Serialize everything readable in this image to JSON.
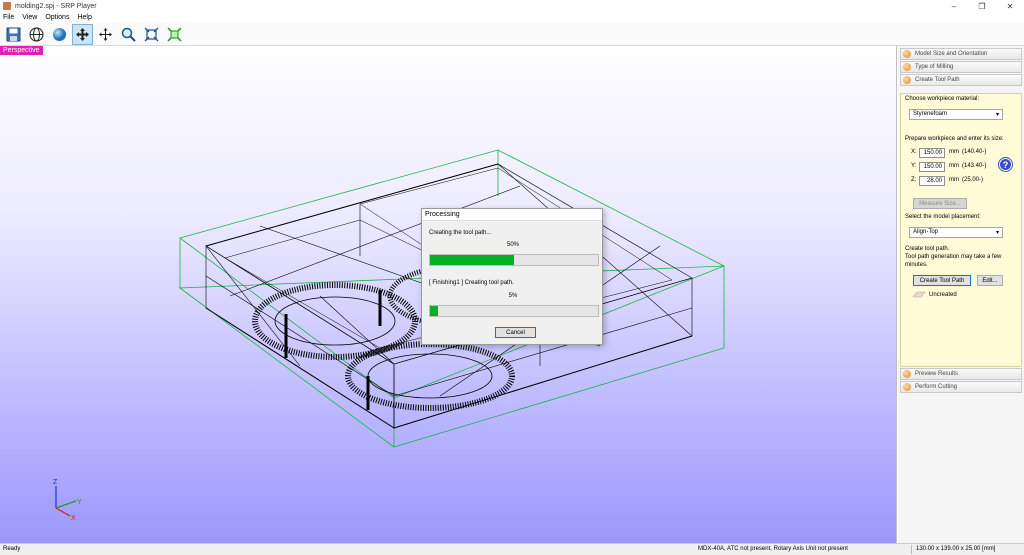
{
  "window": {
    "title": "molding2.spj - SRP Player",
    "controls": [
      "–",
      "❐",
      "✕"
    ]
  },
  "menu": [
    "File",
    "View",
    "Options",
    "Help"
  ],
  "toolbar": {
    "buttons": [
      "save-icon",
      "globe-wire-icon",
      "sphere-icon",
      "rotate-move-icon",
      "pan-icon",
      "zoom-icon",
      "fit-icon",
      "fit-all-icon"
    ],
    "active": "rotate-move-icon"
  },
  "viewport": {
    "view_label": "Perspective",
    "axes": {
      "z": "Z",
      "y": "Y",
      "x": "X"
    }
  },
  "dialog": {
    "title": "Processing",
    "line1": "Creating the tool path...",
    "percent1": "50%",
    "progress1": 0.5,
    "line2": "[ Finishing1 ] Creating tool path.",
    "percent2": "5%",
    "progress2": 0.05,
    "cancel_label": "Cancel"
  },
  "panel": {
    "sections_top": [
      {
        "label": "Model Size and Orientation"
      },
      {
        "label": "Type of Milling"
      },
      {
        "label": "Create Tool Path"
      }
    ],
    "sections_bottom": [
      {
        "label": "Preview Results"
      },
      {
        "label": "Perform Cutting"
      }
    ],
    "material_label": "Choose workpiece material:",
    "material_value": "Styrenefoam",
    "size_label": "Prepare workpiece and enter its size:",
    "sizes": [
      {
        "axis": "X:",
        "value": "150.00",
        "unit": "mm",
        "range": "(140.40-)"
      },
      {
        "axis": "Y:",
        "value": "150.00",
        "unit": "mm",
        "range": "(143.40-)"
      },
      {
        "axis": "Z:",
        "value": "28.00",
        "unit": "mm",
        "range": "(25.00-)"
      }
    ],
    "help_symbol": "?",
    "measure_label": "Measure Size...",
    "placement_label": "Select the model placement:",
    "placement_value": "Align-Top",
    "create_line1": "Create tool path.",
    "create_line2": "Tool path generation may take a few",
    "create_line3": "minutes.",
    "create_button": "Create Tool Path",
    "edit_button": "Edit...",
    "status_text": "Uncreated"
  },
  "statusbar": {
    "left": "Ready",
    "machine": "MDX-40A, ATC not present, Rotary Axis Unit not present",
    "size": "130.00 x 139.00 x 25.00 [mm]"
  },
  "colors": {
    "progress": "#06b025",
    "perspective_tag": "#e11fb3",
    "panel_bg": "#fefbd7",
    "bounding_box": "#19b24a"
  }
}
